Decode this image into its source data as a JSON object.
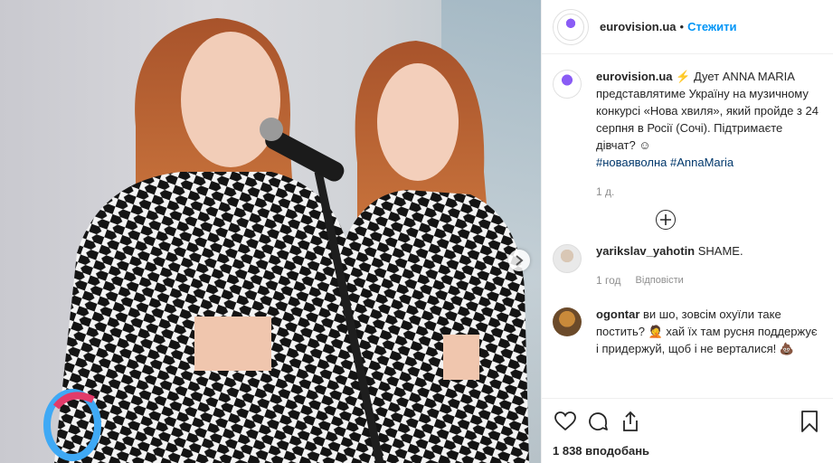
{
  "post": {
    "username": "eurovision.ua",
    "follow_label": "Стежити",
    "dot": "•"
  },
  "caption": {
    "username": "eurovision.ua",
    "text_part1": "⚡ Дует ANNA MARIA представлятиме Україну на музичному конкурсі «Нова хвиля», який пройде з 24 серпня в Росії (Сочі). Підтримаєте дівчат? ☺",
    "hashtag1": "#новаяволна",
    "hashtag2": "#AnnaMaria",
    "time": "1 д."
  },
  "comments": [
    {
      "username": "yarikslav_yahotin",
      "text": "SHAME.",
      "time": "1 год",
      "reply_label": "Відповісти"
    },
    {
      "username": "ogontar",
      "text": "ви шо, зовсім охуїли таке постить? 🤦 хай їх там русня поддержує і придержуй, щоб і не верталися! 💩"
    }
  ],
  "likes": {
    "text": "1 838 вподобань"
  },
  "icons": {
    "next": "chevron-right-icon",
    "like": "heart-icon",
    "comment": "comment-bubble-icon",
    "share": "share-icon",
    "save": "bookmark-icon",
    "load_more": "plus-circle-icon"
  },
  "colors": {
    "accent": "#0095f6",
    "text": "#262626",
    "muted": "#8e8e8e"
  }
}
